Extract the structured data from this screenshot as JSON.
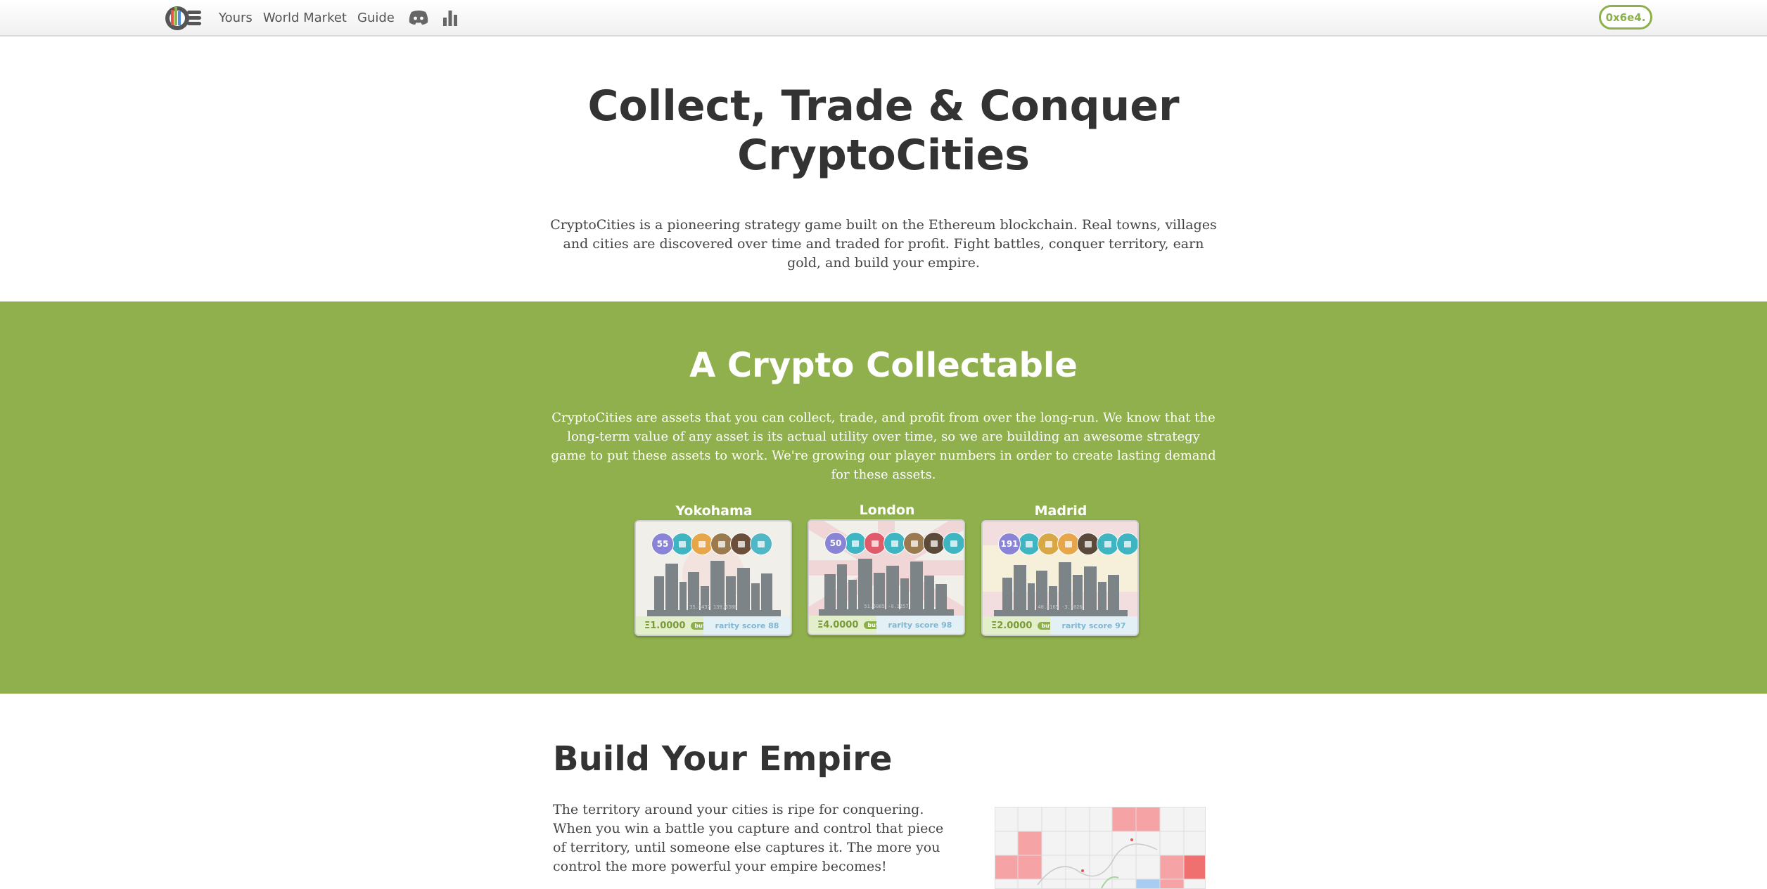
{
  "nav": {
    "links": [
      "Yours",
      "World Market",
      "Guide"
    ],
    "account_label": "0x6e4.",
    "brand_color": "#8db14a",
    "icons": [
      "logo-icon",
      "discord-icon",
      "leaderboard-icon"
    ]
  },
  "hero": {
    "title_line1": "Collect, Trade & Conquer",
    "title_line2": "CryptoCities",
    "text": "CryptoCities is a pioneering strategy game built on the Ethereum blockchain. Real towns, villages and cities are discovered over time and traded for profit. Fight battles, conquer territory, earn gold, and build your empire."
  },
  "collectable": {
    "title": "A Crypto Collectable",
    "text": "CryptoCities are assets that you can collect, trade, and profit from over the long-run. We know that the long-term value of any asset is its actual utility over time, so we are building an awesome strategy game to put these assets to work. We're growing our player numbers in order to create lasting demand for these assets.",
    "background": "#8fb04c",
    "cards": [
      {
        "name": "Yokohama",
        "count": "55",
        "coords": "35.4437 139.6380",
        "price": "Ξ1.0000",
        "buy": "buy",
        "rarity": "rarity score 88",
        "badge_colors": [
          "#3fb5c2",
          "#e8a64a",
          "#9b7a4f",
          "#6b4f3a",
          "#4fb7c5"
        ]
      },
      {
        "name": "London",
        "count": "50",
        "coords": "51.5085 -0.1257",
        "price": "Ξ4.0000",
        "buy": "buy",
        "rarity": "rarity score 98",
        "badge_colors": [
          "#3fb5c2",
          "#e05a6a",
          "#3fb5c2",
          "#9b7a4f",
          "#5b4a3a",
          "#3fb5c2"
        ]
      },
      {
        "name": "Madrid",
        "count": "191",
        "coords": "40.4165 -3.7026",
        "price": "Ξ2.0000",
        "buy": "buy",
        "rarity": "rarity score 97",
        "badge_colors": [
          "#3fb5c2",
          "#d7a845",
          "#e8a64a",
          "#5b4a3a",
          "#3fb5c2",
          "#3fb5c2"
        ]
      }
    ]
  },
  "empire": {
    "title": "Build Your Empire",
    "text": "The territory around your cities is ripe for conquering. When you win a battle you capture and control that piece of territory, until someone else captures it. The more you control the more powerful your empire becomes!"
  }
}
